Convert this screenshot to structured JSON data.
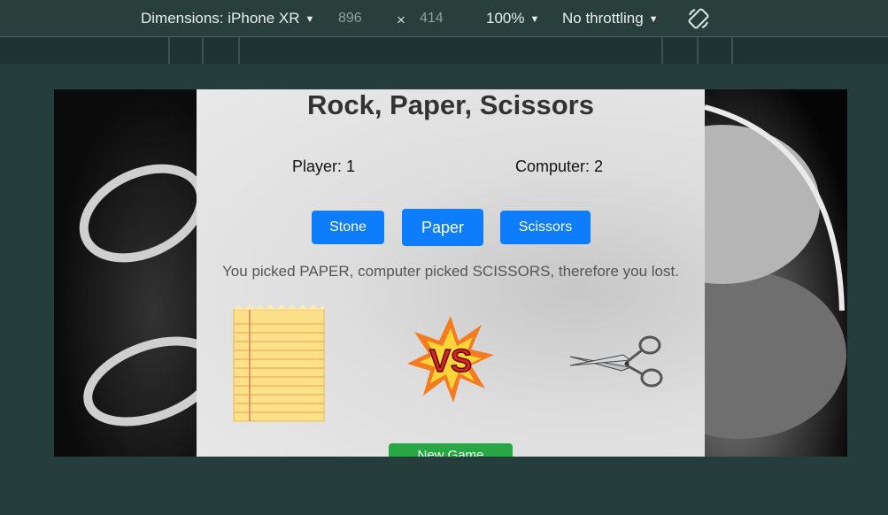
{
  "devtools": {
    "dimensions_label": "Dimensions: iPhone XR",
    "width": "896",
    "times": "×",
    "height": "414",
    "zoom": "100%",
    "throttling": "No throttling",
    "caret": "▼"
  },
  "game": {
    "title": "Rock, Paper, Scissors",
    "player_score": "Player: 1",
    "computer_score": "Computer: 2",
    "buttons": {
      "stone": "Stone",
      "paper": "Paper",
      "scissors": "Scissors"
    },
    "result": "You picked PAPER, computer picked SCISSORS, therefore you lost.",
    "vs_text": "VS",
    "new_game": "New Game"
  },
  "colors": {
    "primary_button": "#0d7dfc",
    "new_game_button": "#28a745",
    "toolbar_bg": "#293f3c"
  }
}
